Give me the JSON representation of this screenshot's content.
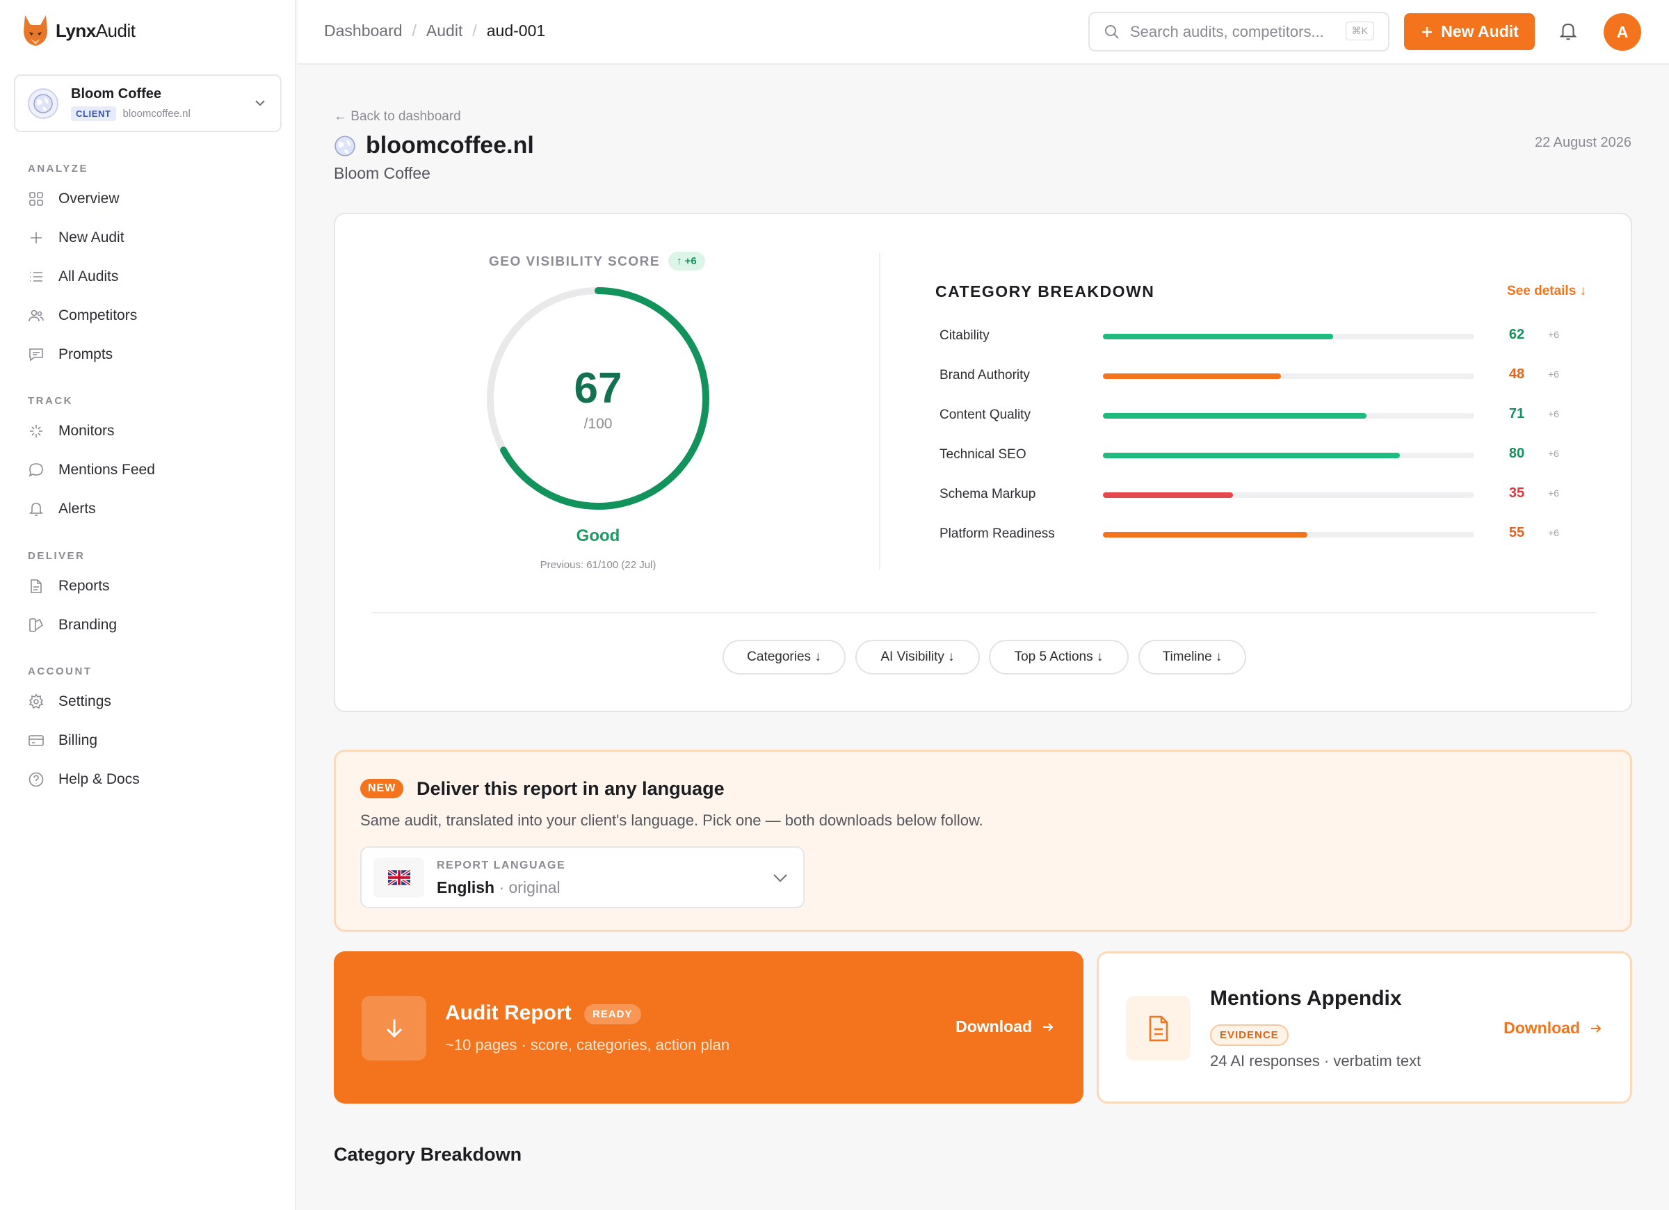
{
  "app": {
    "name_bold": "Lynx",
    "name_rest": "Audit"
  },
  "client": {
    "name": "Bloom Coffee",
    "badge": "CLIENT",
    "domain": "bloomcoffee.nl"
  },
  "nav": {
    "sections": [
      "ANALYZE",
      "TRACK",
      "DELIVER",
      "ACCOUNT"
    ],
    "items": [
      {
        "label": "Overview",
        "icon": "grid-icon"
      },
      {
        "label": "New Audit",
        "icon": "plus-icon"
      },
      {
        "label": "All Audits",
        "icon": "list-icon"
      },
      {
        "label": "Competitors",
        "icon": "users-icon"
      },
      {
        "label": "Prompts",
        "icon": "message-icon"
      },
      {
        "label": "Monitors",
        "icon": "sparkle-icon"
      },
      {
        "label": "Mentions Feed",
        "icon": "chat-icon"
      },
      {
        "label": "Alerts",
        "icon": "bell-icon"
      },
      {
        "label": "Reports",
        "icon": "file-icon"
      },
      {
        "label": "Branding",
        "icon": "palette-icon"
      },
      {
        "label": "Settings",
        "icon": "gear-icon"
      },
      {
        "label": "Billing",
        "icon": "card-icon"
      },
      {
        "label": "Help & Docs",
        "icon": "help-icon"
      }
    ]
  },
  "topbar": {
    "breadcrumbs": [
      "Dashboard",
      "Audit",
      "aud-001"
    ],
    "search_placeholder": "Search audits, competitors...",
    "shortcut": "⌘K",
    "new_audit": "New Audit",
    "avatar_initial": "A"
  },
  "page": {
    "back": "← Back to dashboard",
    "domain": "bloomcoffee.nl",
    "company": "Bloom Coffee",
    "date": "22 August 2026"
  },
  "score": {
    "label": "GEO VISIBILITY SCORE",
    "delta": "↑ +6",
    "value": "67",
    "max": "/100",
    "value_fraction": 0.67,
    "grade": "Good",
    "previous": "Previous: 61/100 (22 Jul)"
  },
  "breakdown": {
    "title": "CATEGORY BREAKDOWN",
    "link": "See details ↓",
    "rows": [
      {
        "name": "Citability",
        "value": "62",
        "delta": "+6",
        "color": "#1fba7d",
        "val_color": "#13935c"
      },
      {
        "name": "Brand Authority",
        "value": "48",
        "delta": "+6",
        "color": "#f4731d",
        "val_color": "#e4621b"
      },
      {
        "name": "Content Quality",
        "value": "71",
        "delta": "+6",
        "color": "#1fba7d",
        "val_color": "#13935c"
      },
      {
        "name": "Technical SEO",
        "value": "80",
        "delta": "+6",
        "color": "#1fba7d",
        "val_color": "#13935c"
      },
      {
        "name": "Schema Markup",
        "value": "35",
        "delta": "+6",
        "color": "#e5484d",
        "val_color": "#d63a3f"
      },
      {
        "name": "Platform Readiness",
        "value": "55",
        "delta": "+6",
        "color": "#f4731d",
        "val_color": "#e4621b"
      }
    ]
  },
  "chips": [
    "Categories ↓",
    "AI Visibility ↓",
    "Top 5 Actions ↓",
    "Timeline ↓"
  ],
  "language": {
    "badge": "NEW",
    "title": "Deliver this report in any language",
    "desc": "Same audit, translated into your client's language. Pick one — both downloads below follow.",
    "label": "REPORT LANGUAGE",
    "value": "English",
    "note": "· original"
  },
  "report": {
    "title": "Audit Report",
    "badge": "READY",
    "desc": "~10 pages · score, categories, action plan",
    "download": "Download"
  },
  "appendix": {
    "title": "Mentions Appendix",
    "badge": "EVIDENCE",
    "desc": "24 AI responses · verbatim text",
    "download": "Download"
  },
  "section_heading": "Category Breakdown",
  "colors": {
    "accent": "#f4731d",
    "good": "#13935c"
  }
}
